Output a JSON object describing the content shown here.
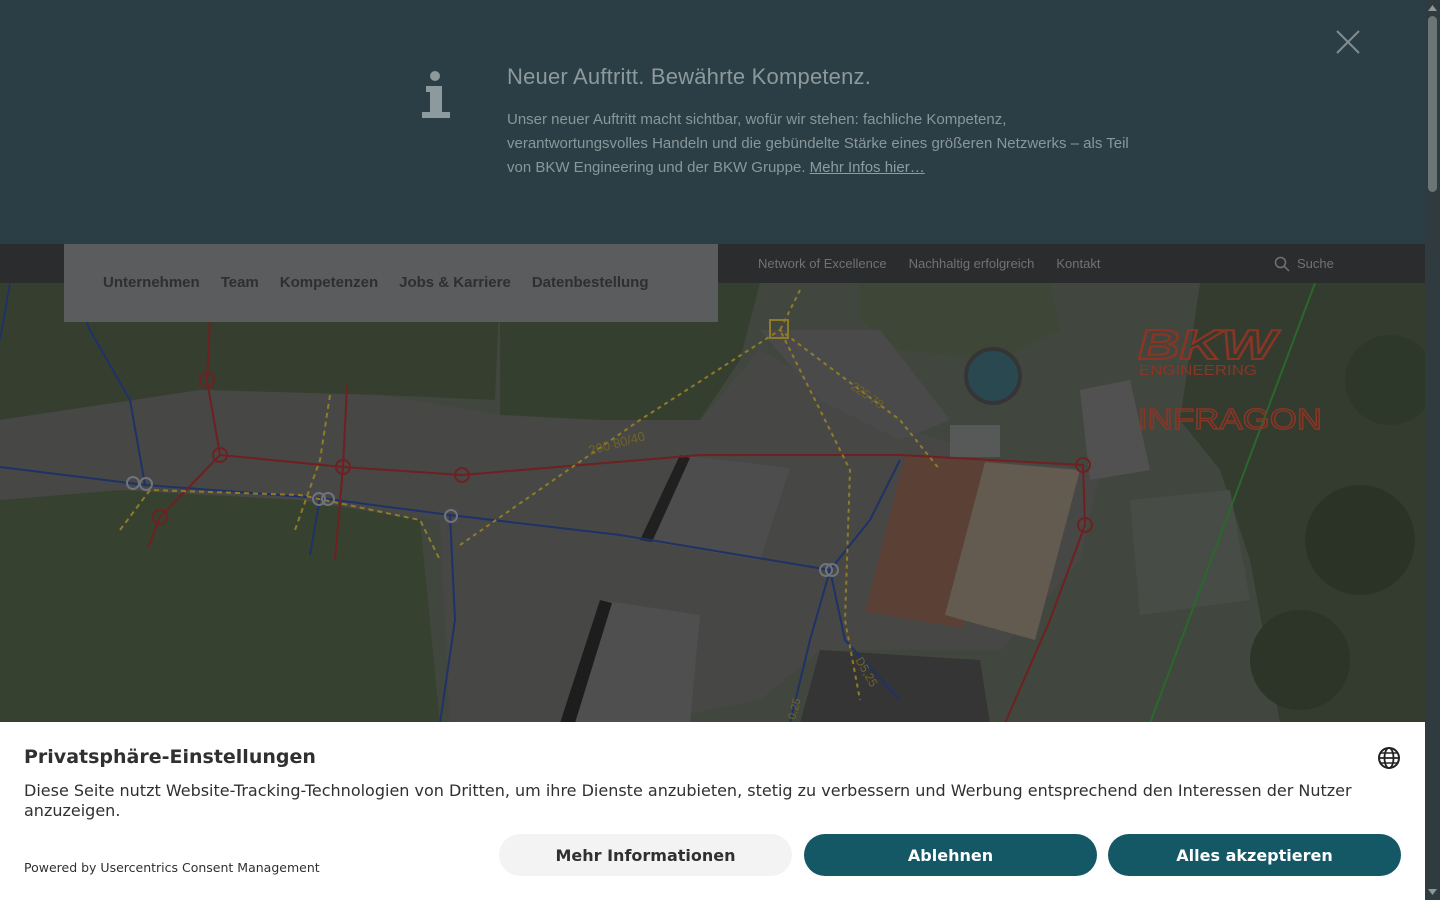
{
  "banner": {
    "title": "Neuer Auftritt. Bewährte Kompetenz.",
    "text": "Unser neuer Auftritt macht sichtbar, wofür wir stehen: fachliche Kompetenz, verantwortungsvolles Handeln und die gebündelte Stärke eines größeren Netzwerks – als Teil von BKW Engineering und der BKW Gruppe. ",
    "link_label": "Mehr Infos hier…",
    "info_icon": "info-icon",
    "close_icon": "close-icon"
  },
  "main_nav": {
    "items": [
      "Unternehmen",
      "Team",
      "Kompetenzen",
      "Jobs & Karriere",
      "Datenbestellung"
    ]
  },
  "meta_nav": {
    "items": [
      "Network of Excellence",
      "Nachhaltig erfolgreich",
      "Kontakt"
    ],
    "search_label": "Suche",
    "search_icon": "search-icon"
  },
  "hero": {
    "logo_line1": "BKW",
    "logo_line2": "ENGINEERING",
    "logo_line3": "INFRAGON",
    "map_labels": [
      "200 80/40",
      "225 78",
      "D5,25",
      "0.25"
    ]
  },
  "consent": {
    "title": "Privatsphäre-Einstellungen",
    "text": "Diese Seite nutzt Website-Tracking-Technologien von Dritten, um ihre Dienste anzubieten, stetig zu verbessern und Werbung entsprechend den Interessen der Nutzer anzuzeigen.",
    "powered_by": "Powered by Usercentrics Consent Management",
    "more_info_label": "Mehr Informationen",
    "deny_label": "Ablehnen",
    "accept_label": "Alles akzeptieren",
    "language_icon": "globe-icon"
  },
  "colors": {
    "banner_bg": "#2b3e45",
    "consent_button": "#145865",
    "logo_red": "#8a3524"
  }
}
